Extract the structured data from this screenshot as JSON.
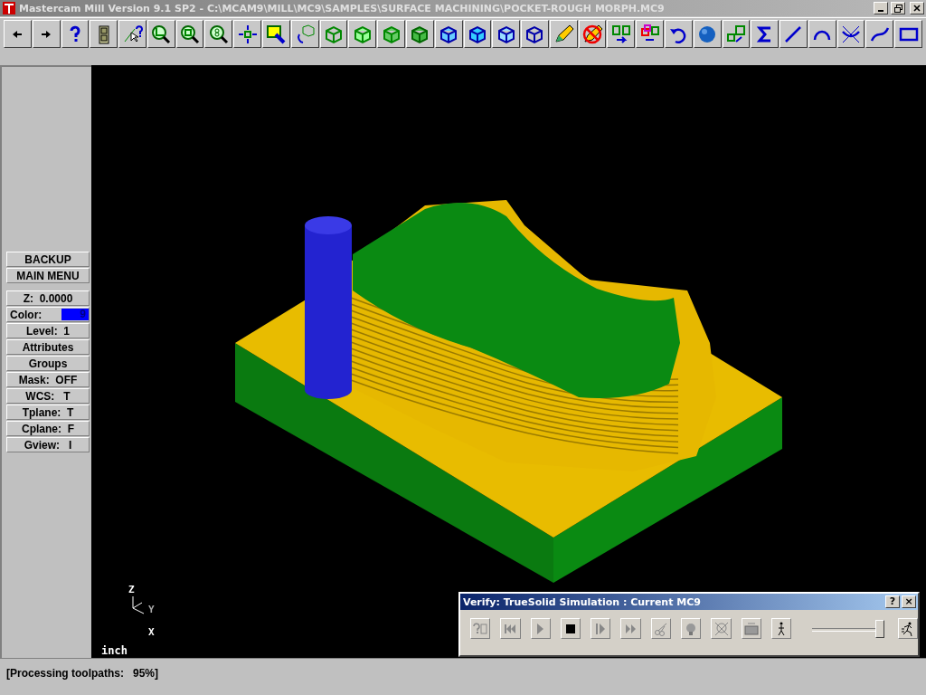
{
  "window": {
    "title": "Mastercam Mill Version 9.1 SP2 - C:\\MCAM9\\MILL\\MC9\\SAMPLES\\SURFACE MACHINING\\POCKET-ROUGH MORPH.MC9"
  },
  "menu": [
    {
      "kind": "button",
      "label": "BACKUP"
    },
    {
      "kind": "button",
      "label": "MAIN MENU"
    },
    {
      "kind": "gap"
    },
    {
      "kind": "button",
      "label": "Z:  0.0000"
    },
    {
      "kind": "swatch",
      "label": "Color:",
      "value": "9",
      "color": "#0000ff"
    },
    {
      "kind": "button",
      "label": "Level:  1"
    },
    {
      "kind": "button",
      "label": "Attributes"
    },
    {
      "kind": "button",
      "label": "Groups"
    },
    {
      "kind": "button",
      "label": "Mask:  OFF"
    },
    {
      "kind": "button",
      "label": "WCS:   T"
    },
    {
      "kind": "button",
      "label": "Tplane:  T"
    },
    {
      "kind": "button",
      "label": "Cplane:  F"
    },
    {
      "kind": "button",
      "label": "Gview:   I"
    }
  ],
  "viewport": {
    "axes": {
      "z": "Z",
      "y": "Y",
      "x": "X"
    },
    "units": "inch"
  },
  "verify": {
    "title": "Verify: TrueSolid Simulation : Current MC9",
    "title_buttons": [
      "?",
      "×"
    ],
    "speed": {
      "level": 0.96
    }
  },
  "status_bar": "[Processing toolpaths:   95%]"
}
